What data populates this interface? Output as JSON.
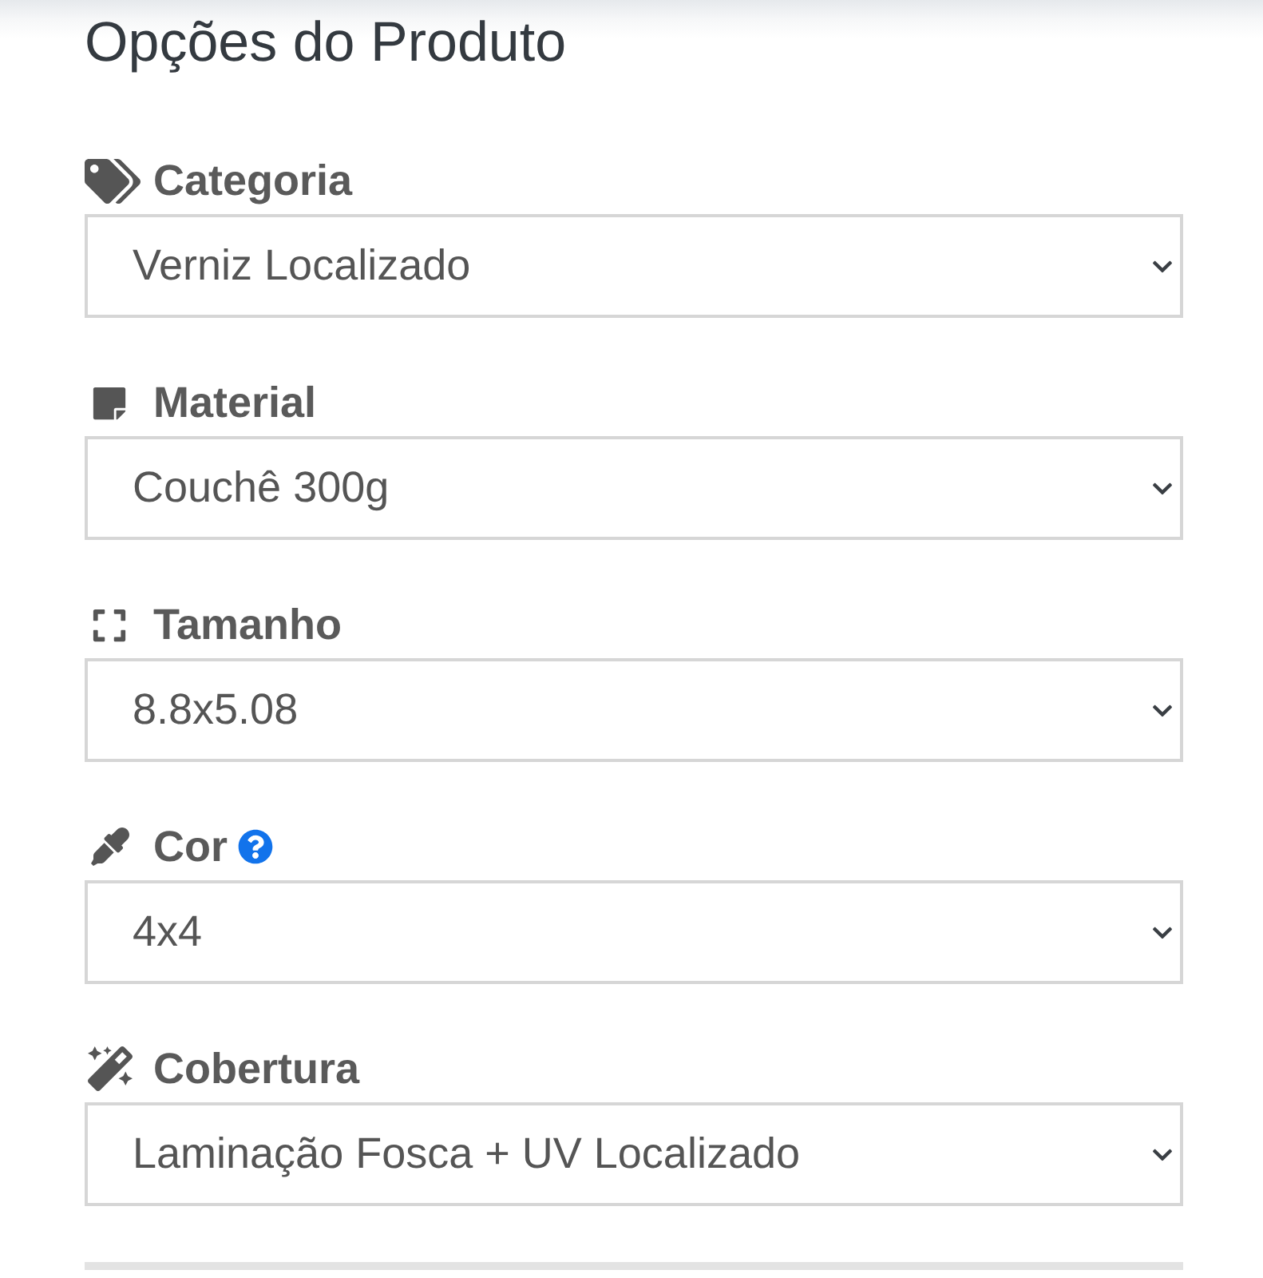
{
  "title": "Opções do Produto",
  "fields": [
    {
      "label": "Categoria",
      "value": "Verniz Localizado",
      "help": false
    },
    {
      "label": "Material",
      "value": "Couchê 300g",
      "help": false
    },
    {
      "label": "Tamanho",
      "value": "8.8x5.08",
      "help": false
    },
    {
      "label": "Cor",
      "value": "4x4",
      "help": true
    },
    {
      "label": "Cobertura",
      "value": "Laminação Fosca + UV Localizado",
      "help": false
    }
  ]
}
